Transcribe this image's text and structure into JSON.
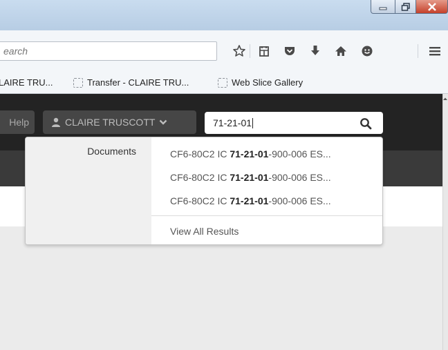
{
  "browser": {
    "search_placeholder": "earch",
    "bookmarks": [
      {
        "label": "LAIRE TRU..."
      },
      {
        "label": "Transfer - CLAIRE TRU..."
      },
      {
        "label": "Web Slice Gallery"
      }
    ],
    "toolbar_icons": [
      "star-icon",
      "reading-list-icon",
      "pocket-icon",
      "download-icon",
      "home-icon",
      "chat-icon",
      "menu-icon"
    ]
  },
  "window_controls": [
    "minimize-icon",
    "maximize-icon",
    "close-icon"
  ],
  "app": {
    "help_label": "Help",
    "user_name": "CLAIRE TRUSCOTT",
    "search_value": "71-21-01"
  },
  "dropdown": {
    "category": "Documents",
    "results": [
      {
        "prefix": "CF6-80C2 IC ",
        "match": "71-21-01",
        "suffix": "-900-006 ES..."
      },
      {
        "prefix": "CF6-80C2 IC ",
        "match": "71-21-01",
        "suffix": "-900-006 ES..."
      },
      {
        "prefix": "CF6-80C2 IC ",
        "match": "71-21-01",
        "suffix": "-900-006 ES..."
      }
    ],
    "view_all": "View All Results"
  }
}
